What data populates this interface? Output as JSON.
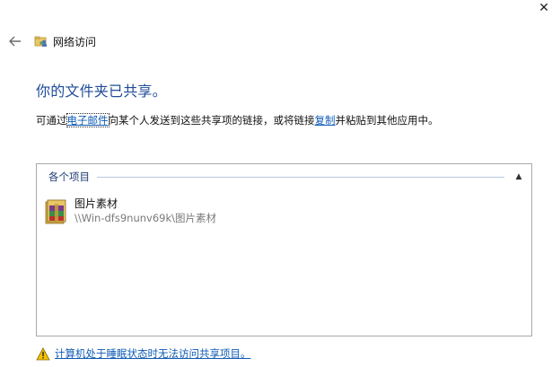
{
  "window": {
    "close_glyph": "✕"
  },
  "nav": {
    "back_icon": "arrow-left-icon",
    "title": "网络访问"
  },
  "heading": "你的文件夹已共享。",
  "description": {
    "prefix": "可通过",
    "email_link": "电子邮件",
    "middle": "向某个人发送到这些共享项的链接，或将链接",
    "copy_link": "复制",
    "suffix": "并粘贴到其他应用中。"
  },
  "group": {
    "label": "各个项目",
    "collapse_glyph": "▲"
  },
  "items": [
    {
      "name": "图片素材",
      "path": "\\\\Win-dfs9nunv69k\\图片素材",
      "icon": "winrar-archive-icon"
    }
  ],
  "footer": {
    "icon": "warning-icon",
    "link_text": "计算机处于睡眠状态时无法访问共享项目。"
  },
  "colors": {
    "heading": "#1f4b99",
    "link": "#0f5bb5",
    "group_label": "#1f3d74",
    "path": "#7a7a7a"
  }
}
